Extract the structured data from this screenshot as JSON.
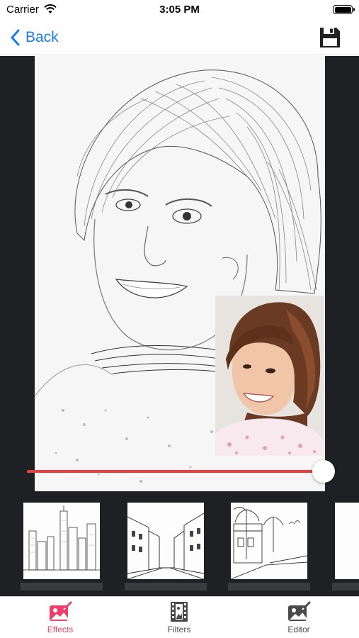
{
  "status": {
    "carrier": "Carrier",
    "time": "3:05 PM"
  },
  "nav": {
    "back_label": "Back"
  },
  "slider": {
    "value": 0.97
  },
  "tabs": [
    {
      "label": "Effects",
      "icon": "effects-icon",
      "active": true
    },
    {
      "label": "Filters",
      "icon": "filters-icon",
      "active": false
    },
    {
      "label": "Editor",
      "icon": "editor-icon",
      "active": false
    }
  ],
  "colors": {
    "accent": "#1a7cf5",
    "active_tab": "#ef3e6b",
    "inactive_tab": "#4a4a4a",
    "slider": "#e93e3a",
    "dark_bg": "#1f2024"
  }
}
